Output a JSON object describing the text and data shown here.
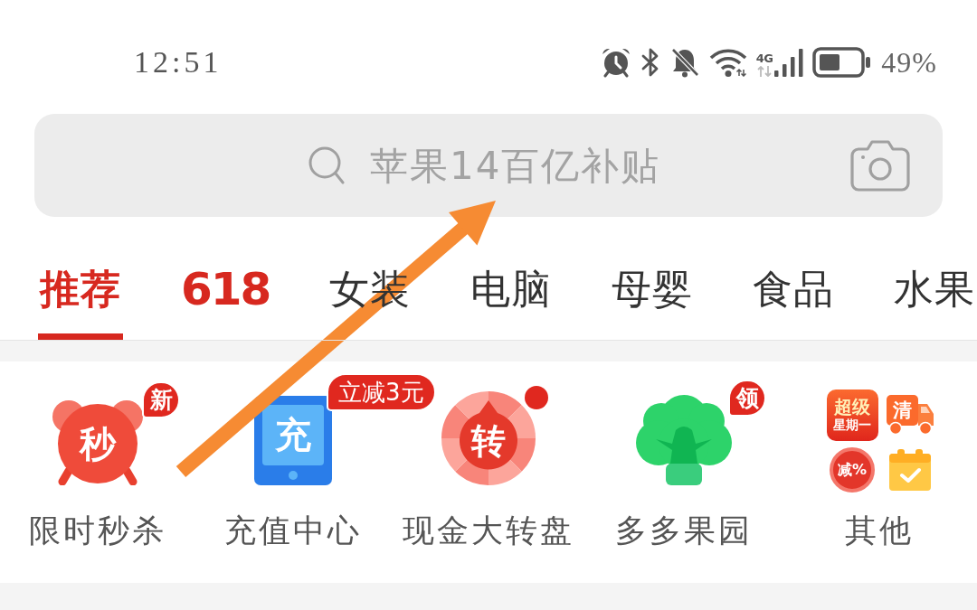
{
  "status_bar": {
    "time": "12:51",
    "network_type": "4G",
    "battery_percent": "49%"
  },
  "search": {
    "placeholder": "苹果14百亿补贴"
  },
  "tabs": [
    {
      "label": "推荐",
      "kind": "text",
      "selected": true
    },
    {
      "label": "618",
      "kind": "promo",
      "selected": false
    },
    {
      "label": "女装",
      "kind": "text",
      "selected": false
    },
    {
      "label": "电脑",
      "kind": "text",
      "selected": false
    },
    {
      "label": "母婴",
      "kind": "text",
      "selected": false
    },
    {
      "label": "食品",
      "kind": "text",
      "selected": false
    },
    {
      "label": "水果",
      "kind": "text",
      "selected": false
    }
  ],
  "shortcuts": [
    {
      "kind": "alarm",
      "icon_text": "秒",
      "badge": {
        "kind": "bubble",
        "text": "新"
      },
      "label": "限时秒杀"
    },
    {
      "kind": "tablet",
      "icon_text": "充",
      "badge": {
        "kind": "tag",
        "text": "立减3元"
      },
      "label": "充值中心"
    },
    {
      "kind": "wheel",
      "icon_text": "转",
      "badge": {
        "kind": "dot"
      },
      "label": "现金大转盘"
    },
    {
      "kind": "tree",
      "badge": {
        "kind": "bubble",
        "text": "领"
      },
      "label": "多多果园"
    },
    {
      "kind": "bundle",
      "tiles": [
        {
          "kind": "promo",
          "lines": [
            "超级",
            "星期一"
          ]
        },
        {
          "kind": "truck",
          "text": "清"
        },
        {
          "kind": "coupon",
          "text": "减%"
        },
        {
          "kind": "calendar"
        }
      ],
      "label": "其他"
    }
  ]
}
